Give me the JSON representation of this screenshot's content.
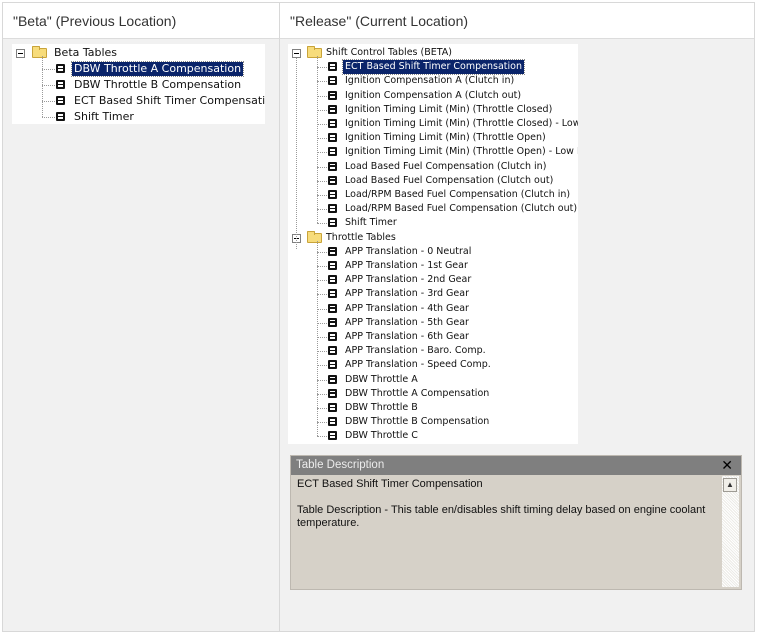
{
  "left_column": {
    "header": "\"Beta\" (Previous Location)",
    "tree": {
      "folder": "Beta Tables",
      "items": [
        {
          "label": "DBW Throttle A Compensation",
          "selected": true
        },
        {
          "label": "DBW Throttle B Compensation",
          "selected": false
        },
        {
          "label": "ECT Based Shift Timer Compensation",
          "selected": false
        },
        {
          "label": "Shift Timer",
          "selected": false
        }
      ]
    }
  },
  "right_column": {
    "header": "\"Release\" (Current Location)",
    "tree": {
      "folders": [
        {
          "label": "Shift Control Tables (BETA)",
          "items": [
            {
              "label": "ECT Based Shift Timer Compensation",
              "selected": true
            },
            {
              "label": "Ignition Compensation A (Clutch in)"
            },
            {
              "label": "Ignition Compensation A (Clutch out)"
            },
            {
              "label": "Ignition Timing Limit (Min) (Throttle Closed)"
            },
            {
              "label": "Ignition Timing Limit (Min) (Throttle Closed) - Low ECT"
            },
            {
              "label": "Ignition Timing Limit (Min) (Throttle Open)"
            },
            {
              "label": "Ignition Timing Limit (Min) (Throttle Open) - Low ECT"
            },
            {
              "label": "Load Based Fuel Compensation (Clutch in)"
            },
            {
              "label": "Load Based Fuel Compensation (Clutch out)"
            },
            {
              "label": "Load/RPM Based Fuel Compensation (Clutch in)"
            },
            {
              "label": "Load/RPM Based Fuel Compensation (Clutch out)"
            },
            {
              "label": "Shift Timer"
            }
          ]
        },
        {
          "label": "Throttle Tables",
          "items": [
            {
              "label": "APP Translation - 0 Neutral"
            },
            {
              "label": "APP Translation - 1st Gear"
            },
            {
              "label": "APP Translation - 2nd Gear"
            },
            {
              "label": "APP Translation - 3rd Gear"
            },
            {
              "label": "APP Translation - 4th Gear"
            },
            {
              "label": "APP Translation - 5th Gear"
            },
            {
              "label": "APP Translation - 6th Gear"
            },
            {
              "label": "APP Translation - Baro. Comp."
            },
            {
              "label": "APP Translation - Speed Comp."
            },
            {
              "label": "DBW Throttle A"
            },
            {
              "label": "DBW Throttle A Compensation"
            },
            {
              "label": "DBW Throttle B"
            },
            {
              "label": "DBW Throttle B Compensation"
            },
            {
              "label": "DBW Throttle C"
            }
          ]
        }
      ]
    },
    "description_panel": {
      "title": "Table Description",
      "close_glyph": "✕",
      "table_name": "ECT Based Shift Timer Compensation",
      "description": "Table Description - This table en/disables shift timing delay based on engine coolant temperature.",
      "scroll_up_glyph": "▲"
    }
  },
  "colors": {
    "selection": "#0a246a",
    "folder": "#f7dc7b",
    "panel_bg": "#d6d1c8",
    "title_bar": "#7f7f7f"
  },
  "icons": {
    "folder": "folder-icon",
    "table": "table-icon",
    "collapse": "minus-box-icon",
    "close": "close-icon",
    "scroll": "scroll-up-arrow-icon"
  }
}
